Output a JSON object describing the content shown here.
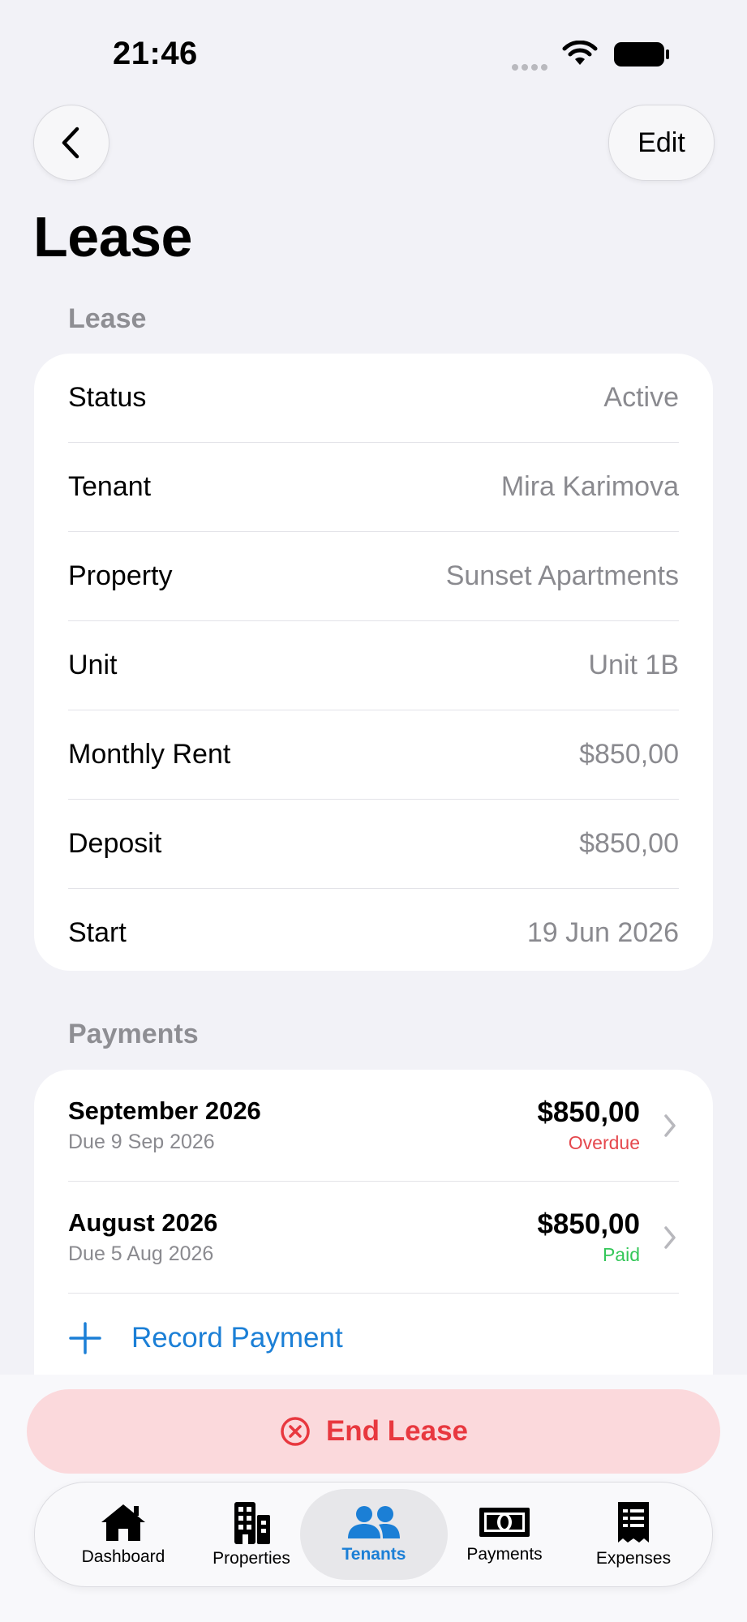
{
  "status_bar": {
    "time": "21:46"
  },
  "nav": {
    "edit_label": "Edit",
    "title": "Lease"
  },
  "lease_section": {
    "header": "Lease",
    "rows": [
      {
        "label": "Status",
        "value": "Active"
      },
      {
        "label": "Tenant",
        "value": "Mira Karimova"
      },
      {
        "label": "Property",
        "value": "Sunset Apartments"
      },
      {
        "label": "Unit",
        "value": "Unit 1B"
      },
      {
        "label": "Monthly Rent",
        "value": "$850,00"
      },
      {
        "label": "Deposit",
        "value": "$850,00"
      },
      {
        "label": "Start",
        "value": "19 Jun 2026"
      }
    ]
  },
  "payments_section": {
    "header": "Payments",
    "items": [
      {
        "title": "September 2026",
        "due": "Due 9 Sep 2026",
        "amount": "$850,00",
        "status": "Overdue",
        "status_color": "#e5484d"
      },
      {
        "title": "August 2026",
        "due": "Due 5 Aug 2026",
        "amount": "$850,00",
        "status": "Paid",
        "status_color": "#34c759"
      }
    ],
    "record_label": "Record Payment"
  },
  "end_lease": {
    "label": "End Lease"
  },
  "tabs": [
    {
      "label": "Dashboard",
      "icon": "house-icon"
    },
    {
      "label": "Properties",
      "icon": "building-icon"
    },
    {
      "label": "Tenants",
      "icon": "people-icon",
      "active": true
    },
    {
      "label": "Payments",
      "icon": "banknote-icon"
    },
    {
      "label": "Expenses",
      "icon": "receipt-icon"
    }
  ],
  "colors": {
    "accent": "#1b7fd6",
    "danger": "#e8383f",
    "success": "#34c759"
  }
}
